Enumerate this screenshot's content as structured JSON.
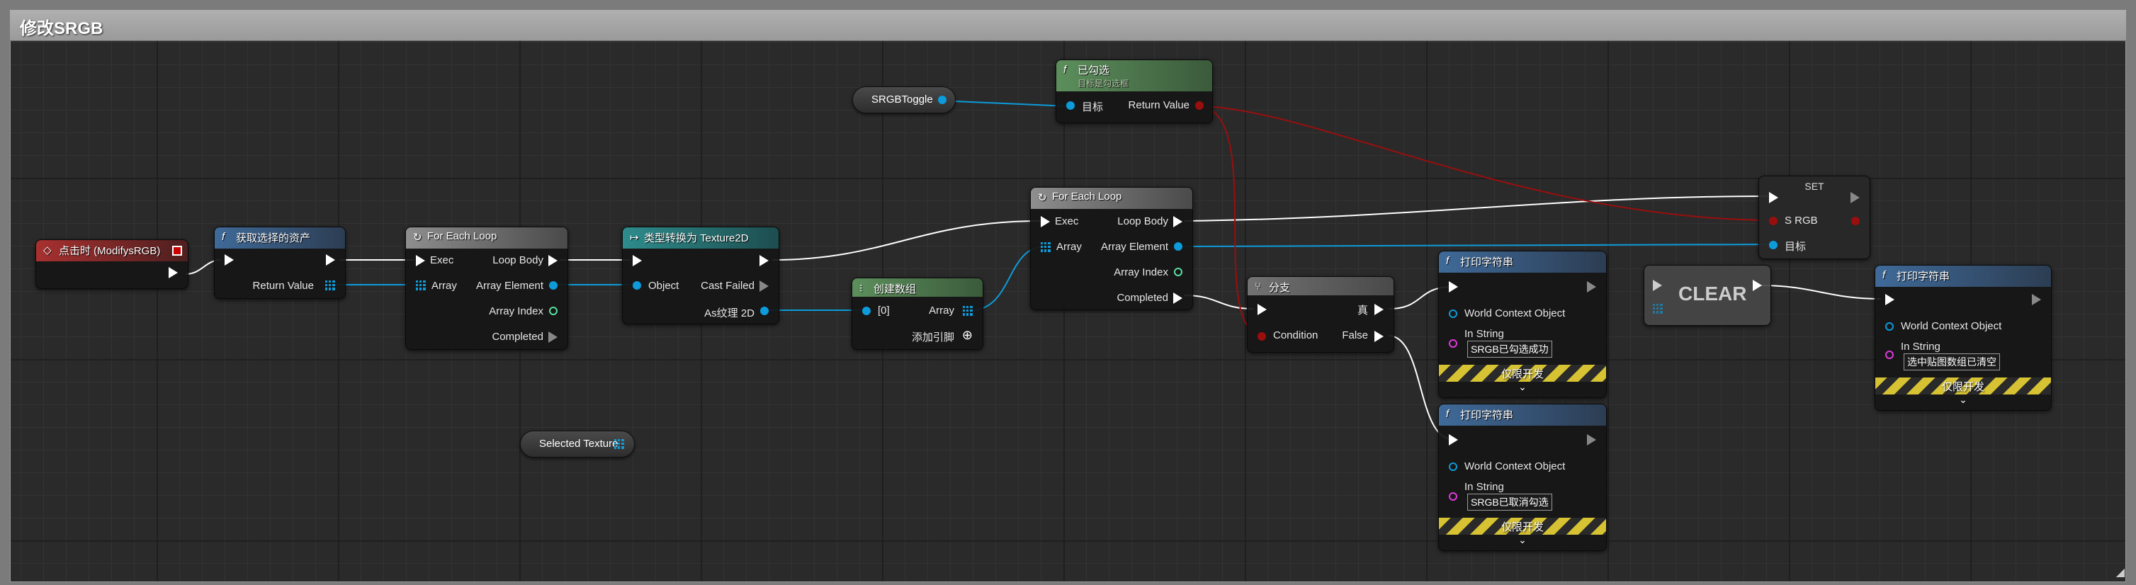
{
  "graph": {
    "title": "修改SRGB"
  },
  "colors": {
    "exec": "#ffffff",
    "object": "#0d9bd9",
    "bool": "#9b0e0e",
    "string": "#e038e0",
    "int": "#5ae0a2",
    "dev_stripe": "#d6c232"
  },
  "nodes": {
    "event": {
      "title": "点击时 (ModifysRGB)"
    },
    "get_selected": {
      "title": "获取选择的资产",
      "return_value": "Return Value"
    },
    "loop1": {
      "title": "For Each Loop",
      "exec": "Exec",
      "loop_body": "Loop Body",
      "array": "Array",
      "array_element": "Array Element",
      "array_index": "Array Index",
      "completed": "Completed"
    },
    "cast": {
      "title": "类型转换为 Texture2D",
      "object": "Object",
      "cast_failed": "Cast Failed",
      "as_texture": "As纹理 2D"
    },
    "make_array": {
      "title": "创建数组",
      "index0": "[0]",
      "array": "Array",
      "add_pin": "添加引脚"
    },
    "srgb_toggle": {
      "label": "SRGBToggle"
    },
    "is_checked": {
      "title": "已勾选",
      "subtitle": "目标是勾选框",
      "target": "目标",
      "return_value": "Return Value"
    },
    "loop2": {
      "title": "For Each Loop",
      "exec": "Exec",
      "loop_body": "Loop Body",
      "array": "Array",
      "array_element": "Array Element",
      "array_index": "Array Index",
      "completed": "Completed"
    },
    "branch": {
      "title": "分支",
      "condition": "Condition",
      "true_label": "真",
      "false_label": "False"
    },
    "print1": {
      "title": "打印字符串",
      "world_context": "World Context Object",
      "in_string": "In String",
      "value": "SRGB已勾选成功",
      "dev_only": "仅限开发"
    },
    "print2": {
      "title": "打印字符串",
      "world_context": "World Context Object",
      "in_string": "In String",
      "value": "SRGB已取消勾选",
      "dev_only": "仅限开发"
    },
    "set_node": {
      "title": "SET",
      "srgb": "S RGB",
      "target": "目标"
    },
    "clear": {
      "label": "CLEAR"
    },
    "print3": {
      "title": "打印字符串",
      "world_context": "World Context Object",
      "in_string": "In String",
      "value": "选中贴图数组已清空",
      "dev_only": "仅限开发"
    },
    "selected_texture": {
      "label": "Selected Texture"
    }
  }
}
